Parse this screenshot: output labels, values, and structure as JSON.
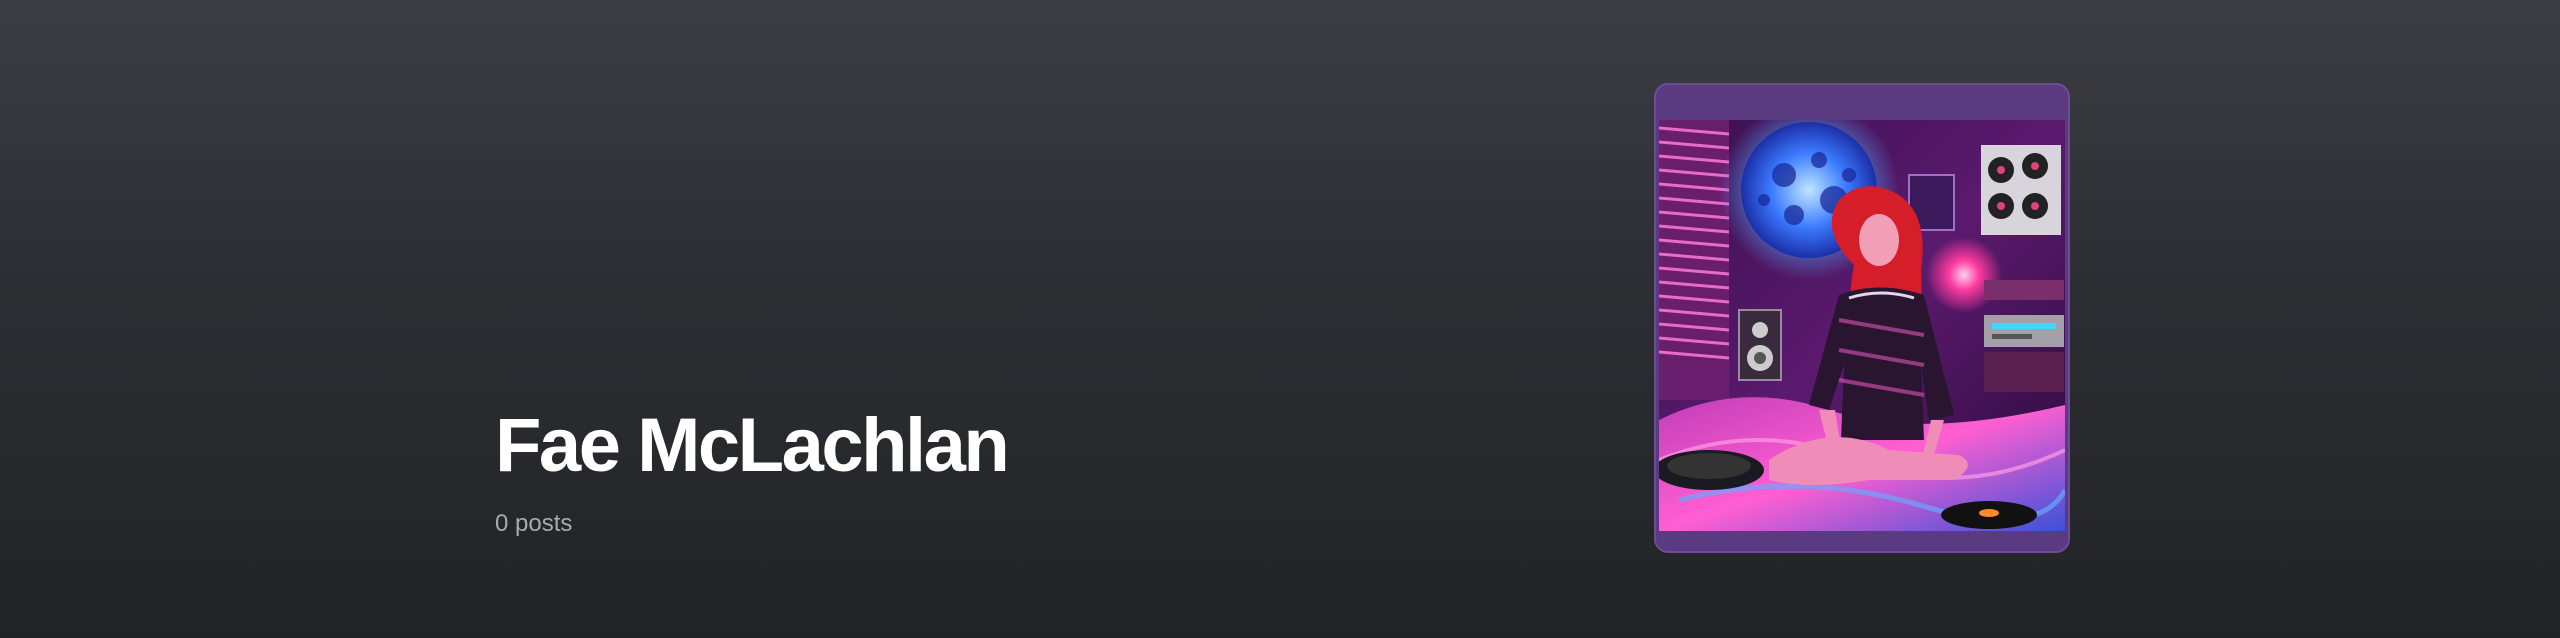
{
  "author": {
    "name": "Fae McLachlan",
    "post_count": "0 posts"
  },
  "profile_image": {
    "alt": "Fae McLachlan"
  },
  "colors": {
    "background_top": "#3a3d42",
    "background_bottom": "#222326",
    "card_frame": "#5a3a80",
    "name_text": "#ffffff",
    "meta_text": "#a7a9ae"
  }
}
